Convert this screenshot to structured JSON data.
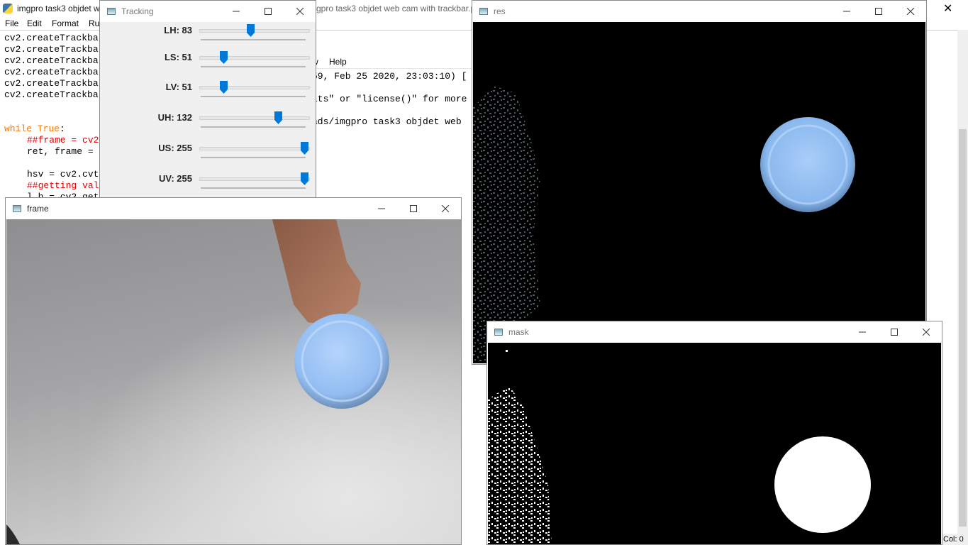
{
  "taskbar_icon": "python-icon",
  "editor": {
    "title": "imgpro task3 objdet w",
    "title_right": "gpro task3 objdet web cam with trackbar.p",
    "menu": [
      "File",
      "Edit",
      "Format",
      "Ru"
    ],
    "lines": [
      "cv2.createTrackba",
      "cv2.createTrackba",
      "cv2.createTrackba",
      "cv2.createTrackba",
      "cv2.createTrackba",
      "cv2.createTrackba"
    ],
    "while_kw": "while True",
    "while_rest": ":",
    "l2": "##frame = cv2",
    "l3": "ret, frame =",
    "l4": "hsv = cv2.cvt",
    "l5": "##getting val",
    "l6": "l_h = cv2.get",
    "status_col": "Col: 0"
  },
  "shell": {
    "menu_frag1": "w",
    "menu_help": "Help",
    "line1": "59, Feb 25 2020, 23:03:10) [",
    "line2": "its\" or \"license()\" for more",
    "line3": "ads/imgpro task3 objdet web"
  },
  "tracking": {
    "title": "Tracking",
    "trackbars": [
      {
        "label": "LH: 83",
        "value": 83,
        "max": 179
      },
      {
        "label": "LS: 51",
        "value": 51,
        "max": 255
      },
      {
        "label": "LV: 51",
        "value": 51,
        "max": 255
      },
      {
        "label": "UH: 132",
        "value": 132,
        "max": 179
      },
      {
        "label": "US: 255",
        "value": 255,
        "max": 255
      },
      {
        "label": "UV: 255",
        "value": 255,
        "max": 255
      }
    ]
  },
  "frame": {
    "title": "frame"
  },
  "res": {
    "title": "res"
  },
  "mask": {
    "title": "mask"
  },
  "colors": {
    "thumb": "#0078d7",
    "ball": "#9cc4f5",
    "code_keyword": "#ff7700",
    "code_comment": "#dd0000"
  }
}
